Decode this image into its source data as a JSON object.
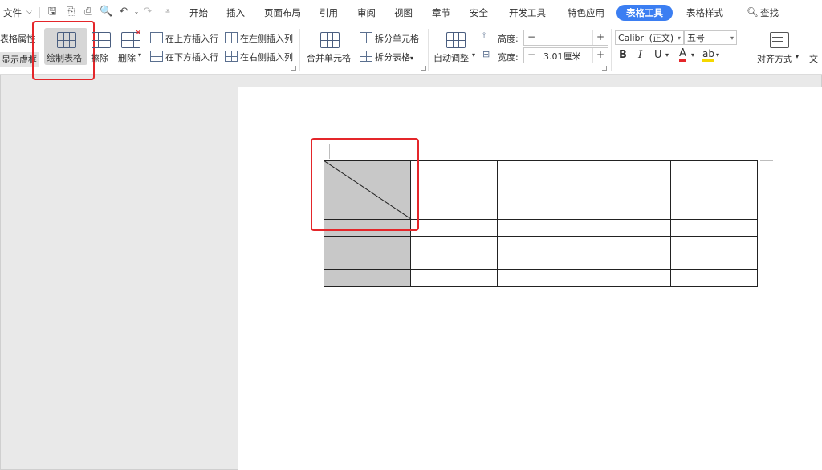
{
  "menubar": {
    "file": "文件",
    "tabs": [
      "开始",
      "插入",
      "页面布局",
      "引用",
      "审阅",
      "视图",
      "章节",
      "安全",
      "开发工具",
      "特色应用"
    ],
    "active_tab": "表格工具",
    "style_tab": "表格样式",
    "search": "查找"
  },
  "ribbon": {
    "table_props": "表格属性",
    "show_grid": "显示虚框",
    "draw_table": "绘制表格",
    "erase": "擦除",
    "delete": "删除",
    "insert_above": "在上方插入行",
    "insert_below": "在下方插入行",
    "insert_left": "在左侧插入列",
    "insert_right": "在右侧插入列",
    "merge_cells": "合并单元格",
    "split_cells": "拆分单元格",
    "split_table": "拆分表格",
    "auto_fit": "自动调整",
    "height_label": "高度:",
    "height_value": "",
    "width_label": "宽度:",
    "width_value": "3.01厘米",
    "font_name": "Calibri (正文)",
    "font_size": "五号",
    "bold": "B",
    "italic": "I",
    "underline": "U",
    "font_color": "A",
    "highlight": "ab",
    "align": "对齐方式",
    "text_dir": "文"
  },
  "table": {
    "rows": 5,
    "cols": 5
  },
  "colors": {
    "accent": "#3b7ef2",
    "highlight_box": "#e4262a",
    "cell_shade": "#c8c8c8"
  }
}
